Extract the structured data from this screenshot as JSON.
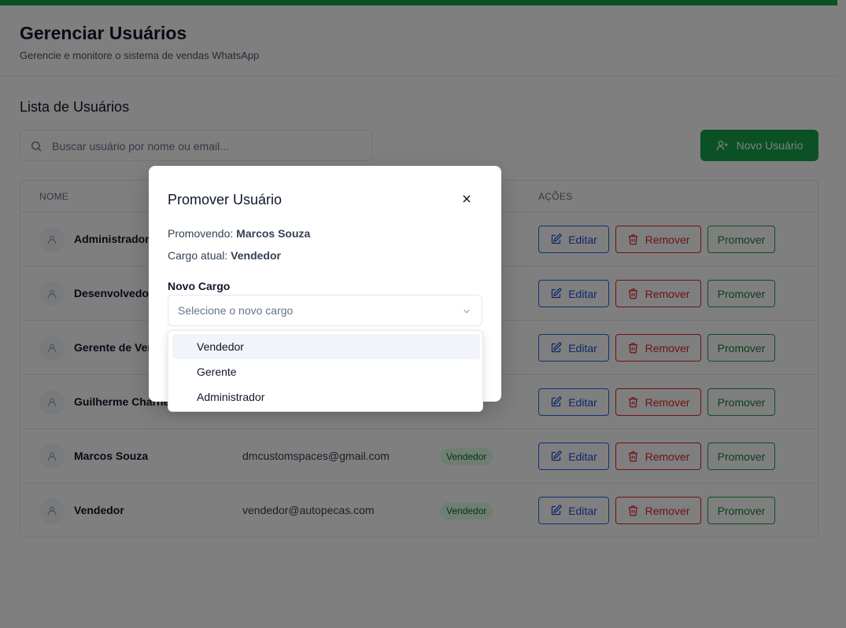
{
  "header": {
    "title": "Gerenciar Usuários",
    "subtitle": "Gerencie e monitore o sistema de vendas WhatsApp"
  },
  "section_title": "Lista de Usuários",
  "search": {
    "placeholder": "Buscar usuário por nome ou email..."
  },
  "new_user_label": "Novo Usuário",
  "table": {
    "headers": {
      "name": "NOME",
      "actions": "AÇÕES"
    },
    "rows": [
      {
        "name": "Administrador",
        "email": "",
        "role": ""
      },
      {
        "name": "Desenvolvedor",
        "email": "",
        "role": ""
      },
      {
        "name": "Gerente de Ven",
        "email": "",
        "role": ""
      },
      {
        "name": "Guilherme Charner",
        "email": "",
        "role": ""
      },
      {
        "name": "Marcos Souza",
        "email": "dmcustomspaces@gmail.com",
        "role": "Vendedor"
      },
      {
        "name": "Vendedor",
        "email": "vendedor@autopecas.com",
        "role": "Vendedor"
      }
    ],
    "actions": {
      "edit": "Editar",
      "remove": "Remover",
      "promote": "Promover"
    }
  },
  "modal": {
    "title": "Promover Usuário",
    "promoting_label": "Promovendo:",
    "promoting_value": "Marcos Souza",
    "current_role_label": "Cargo atual:",
    "current_role_value": "Vendedor",
    "new_role_label": "Novo Cargo",
    "select_placeholder": "Selecione o novo cargo",
    "options": [
      "Vendedor",
      "Gerente",
      "Administrador"
    ],
    "highlighted_option": "Vendedor"
  },
  "colors": {
    "accent": "#16a34a",
    "edit": "#2563eb",
    "remove": "#dc2626",
    "overlay": "rgba(0,0,0,0.5)"
  }
}
